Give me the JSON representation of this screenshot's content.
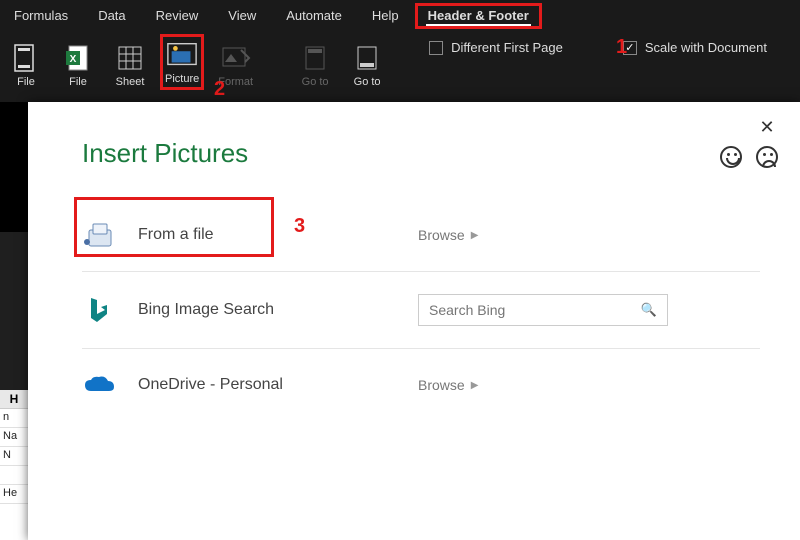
{
  "ribbon": {
    "tabs": {
      "formulas": "Formulas",
      "data": "Data",
      "review": "Review",
      "view": "View",
      "automate": "Automate",
      "help": "Help",
      "header_footer": "Header & Footer"
    },
    "buttons": {
      "file1": "File",
      "file2": "File",
      "sheet": "Sheet",
      "picture": "Picture",
      "format": "Format",
      "goto1": "Go to",
      "goto2": "Go to"
    },
    "checks": {
      "different_first": "Different First Page",
      "scale_doc": "Scale with Document"
    }
  },
  "annotations": {
    "n1": "1",
    "n2": "2",
    "n3": "3"
  },
  "dialog": {
    "title": "Insert Pictures",
    "close": "✕",
    "options": {
      "from_file": {
        "label": "From a file",
        "action": "Browse"
      },
      "bing": {
        "label": "Bing Image Search",
        "placeholder": "Search Bing"
      },
      "onedrive": {
        "label": "OneDrive - Personal",
        "action": "Browse"
      }
    }
  },
  "sheet": {
    "header": "H",
    "rows": [
      "n",
      "Na",
      "N",
      "",
      "He"
    ]
  }
}
